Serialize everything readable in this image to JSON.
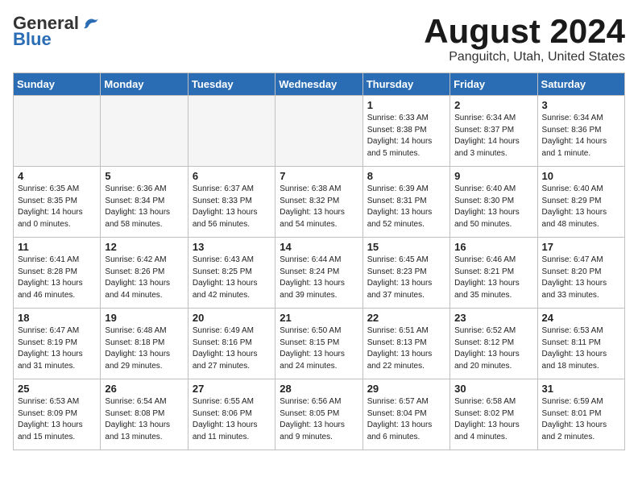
{
  "header": {
    "logo_general": "General",
    "logo_blue": "Blue",
    "month_title": "August 2024",
    "location": "Panguitch, Utah, United States"
  },
  "weekdays": [
    "Sunday",
    "Monday",
    "Tuesday",
    "Wednesday",
    "Thursday",
    "Friday",
    "Saturday"
  ],
  "weeks": [
    [
      {
        "day": "",
        "info": ""
      },
      {
        "day": "",
        "info": ""
      },
      {
        "day": "",
        "info": ""
      },
      {
        "day": "",
        "info": ""
      },
      {
        "day": "1",
        "info": "Sunrise: 6:33 AM\nSunset: 8:38 PM\nDaylight: 14 hours\nand 5 minutes."
      },
      {
        "day": "2",
        "info": "Sunrise: 6:34 AM\nSunset: 8:37 PM\nDaylight: 14 hours\nand 3 minutes."
      },
      {
        "day": "3",
        "info": "Sunrise: 6:34 AM\nSunset: 8:36 PM\nDaylight: 14 hours\nand 1 minute."
      }
    ],
    [
      {
        "day": "4",
        "info": "Sunrise: 6:35 AM\nSunset: 8:35 PM\nDaylight: 14 hours\nand 0 minutes."
      },
      {
        "day": "5",
        "info": "Sunrise: 6:36 AM\nSunset: 8:34 PM\nDaylight: 13 hours\nand 58 minutes."
      },
      {
        "day": "6",
        "info": "Sunrise: 6:37 AM\nSunset: 8:33 PM\nDaylight: 13 hours\nand 56 minutes."
      },
      {
        "day": "7",
        "info": "Sunrise: 6:38 AM\nSunset: 8:32 PM\nDaylight: 13 hours\nand 54 minutes."
      },
      {
        "day": "8",
        "info": "Sunrise: 6:39 AM\nSunset: 8:31 PM\nDaylight: 13 hours\nand 52 minutes."
      },
      {
        "day": "9",
        "info": "Sunrise: 6:40 AM\nSunset: 8:30 PM\nDaylight: 13 hours\nand 50 minutes."
      },
      {
        "day": "10",
        "info": "Sunrise: 6:40 AM\nSunset: 8:29 PM\nDaylight: 13 hours\nand 48 minutes."
      }
    ],
    [
      {
        "day": "11",
        "info": "Sunrise: 6:41 AM\nSunset: 8:28 PM\nDaylight: 13 hours\nand 46 minutes."
      },
      {
        "day": "12",
        "info": "Sunrise: 6:42 AM\nSunset: 8:26 PM\nDaylight: 13 hours\nand 44 minutes."
      },
      {
        "day": "13",
        "info": "Sunrise: 6:43 AM\nSunset: 8:25 PM\nDaylight: 13 hours\nand 42 minutes."
      },
      {
        "day": "14",
        "info": "Sunrise: 6:44 AM\nSunset: 8:24 PM\nDaylight: 13 hours\nand 39 minutes."
      },
      {
        "day": "15",
        "info": "Sunrise: 6:45 AM\nSunset: 8:23 PM\nDaylight: 13 hours\nand 37 minutes."
      },
      {
        "day": "16",
        "info": "Sunrise: 6:46 AM\nSunset: 8:21 PM\nDaylight: 13 hours\nand 35 minutes."
      },
      {
        "day": "17",
        "info": "Sunrise: 6:47 AM\nSunset: 8:20 PM\nDaylight: 13 hours\nand 33 minutes."
      }
    ],
    [
      {
        "day": "18",
        "info": "Sunrise: 6:47 AM\nSunset: 8:19 PM\nDaylight: 13 hours\nand 31 minutes."
      },
      {
        "day": "19",
        "info": "Sunrise: 6:48 AM\nSunset: 8:18 PM\nDaylight: 13 hours\nand 29 minutes."
      },
      {
        "day": "20",
        "info": "Sunrise: 6:49 AM\nSunset: 8:16 PM\nDaylight: 13 hours\nand 27 minutes."
      },
      {
        "day": "21",
        "info": "Sunrise: 6:50 AM\nSunset: 8:15 PM\nDaylight: 13 hours\nand 24 minutes."
      },
      {
        "day": "22",
        "info": "Sunrise: 6:51 AM\nSunset: 8:13 PM\nDaylight: 13 hours\nand 22 minutes."
      },
      {
        "day": "23",
        "info": "Sunrise: 6:52 AM\nSunset: 8:12 PM\nDaylight: 13 hours\nand 20 minutes."
      },
      {
        "day": "24",
        "info": "Sunrise: 6:53 AM\nSunset: 8:11 PM\nDaylight: 13 hours\nand 18 minutes."
      }
    ],
    [
      {
        "day": "25",
        "info": "Sunrise: 6:53 AM\nSunset: 8:09 PM\nDaylight: 13 hours\nand 15 minutes."
      },
      {
        "day": "26",
        "info": "Sunrise: 6:54 AM\nSunset: 8:08 PM\nDaylight: 13 hours\nand 13 minutes."
      },
      {
        "day": "27",
        "info": "Sunrise: 6:55 AM\nSunset: 8:06 PM\nDaylight: 13 hours\nand 11 minutes."
      },
      {
        "day": "28",
        "info": "Sunrise: 6:56 AM\nSunset: 8:05 PM\nDaylight: 13 hours\nand 9 minutes."
      },
      {
        "day": "29",
        "info": "Sunrise: 6:57 AM\nSunset: 8:04 PM\nDaylight: 13 hours\nand 6 minutes."
      },
      {
        "day": "30",
        "info": "Sunrise: 6:58 AM\nSunset: 8:02 PM\nDaylight: 13 hours\nand 4 minutes."
      },
      {
        "day": "31",
        "info": "Sunrise: 6:59 AM\nSunset: 8:01 PM\nDaylight: 13 hours\nand 2 minutes."
      }
    ]
  ]
}
